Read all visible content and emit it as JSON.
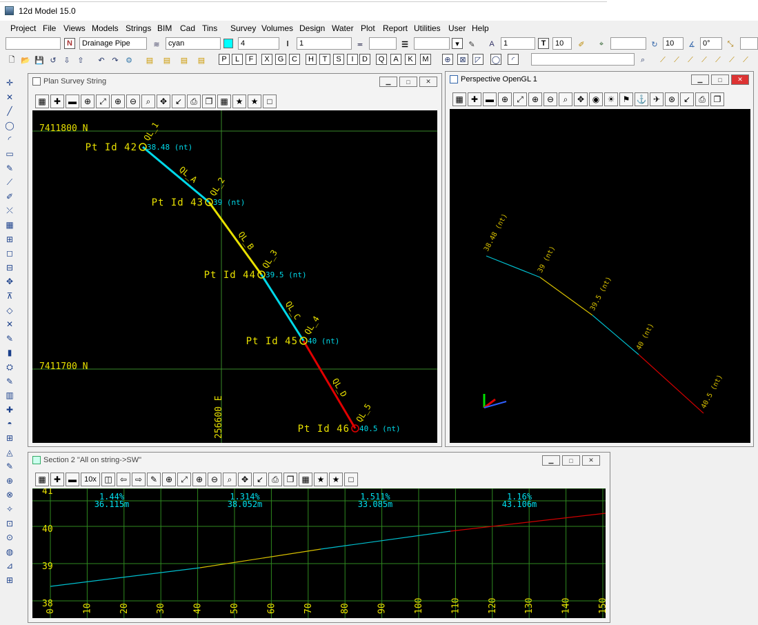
{
  "app": {
    "title": "12d Model  15.0"
  },
  "menu": [
    "Project",
    "File",
    "Views",
    "Models",
    "Strings",
    "BIM",
    "Cad",
    "Tins",
    "Survey",
    "Volumes",
    "Design",
    "Water",
    "Plot",
    "Report",
    "Utilities",
    "User",
    "Help"
  ],
  "toolbar1": {
    "field_blank": "",
    "name_flag": "N",
    "name": "Drainage Pipe",
    "colour": "cyan",
    "colour_hex": "#00ffff",
    "weight": "4",
    "linestyle_field": "1",
    "text_size_field": "1",
    "text_glyph": "T",
    "text_size": "10",
    "angle_size": "10",
    "angle": "0°"
  },
  "toolbar2": {
    "letters": [
      "P",
      "L",
      "F",
      "X",
      "G",
      "C",
      "H",
      "T",
      "S",
      "I",
      "D",
      "Q",
      "A",
      "K",
      "M"
    ]
  },
  "plan": {
    "title": "Plan Survey String",
    "grid_north_top": "7411800  N",
    "grid_north_bot": "7411700  N",
    "grid_east": "256600  E",
    "points": [
      {
        "id": "Pt Id 42",
        "elev": "38.48 (nt)",
        "ql": "QL_1"
      },
      {
        "id": "Pt Id 43",
        "elev": "39 (nt)",
        "ql": "QL_2"
      },
      {
        "id": "Pt Id 44",
        "elev": "39.5 (nt)",
        "ql": "QL_3"
      },
      {
        "id": "Pt Id 45",
        "elev": "40 (nt)",
        "ql": "QL_4"
      },
      {
        "id": "Pt Id 46",
        "elev": "40.5 (nt)",
        "ql": "QL_5"
      }
    ],
    "segments": [
      {
        "label": "QL_A",
        "color": "#00d8e8"
      },
      {
        "label": "QL_B",
        "color": "#e8e000"
      },
      {
        "label": "QL_C",
        "color": "#00d8e8"
      },
      {
        "label": "QL_D",
        "color": "#e00000"
      }
    ]
  },
  "persp": {
    "title": "Perspective OpenGL 1",
    "labels": [
      "38.48 (nt)",
      "39 (nt)",
      "39.5 (nt)",
      "40 (nt)",
      "40.5 (nt)"
    ]
  },
  "section": {
    "title": "Section 2 \"All on string->SW\"",
    "scale_button": "10x",
    "grades": [
      {
        "grade": "1.44%",
        "length": "36.115m"
      },
      {
        "grade": "1.314%",
        "length": "38.052m"
      },
      {
        "grade": "1.511%",
        "length": "33.085m"
      },
      {
        "grade": "1.16%",
        "length": "43.106m"
      }
    ],
    "y_labels": [
      "41",
      "40",
      "39",
      "38"
    ],
    "x_labels": [
      "0",
      "10",
      "20",
      "30",
      "40",
      "50",
      "60",
      "70",
      "80",
      "90",
      "100",
      "110",
      "120",
      "130",
      "140",
      "150"
    ]
  }
}
